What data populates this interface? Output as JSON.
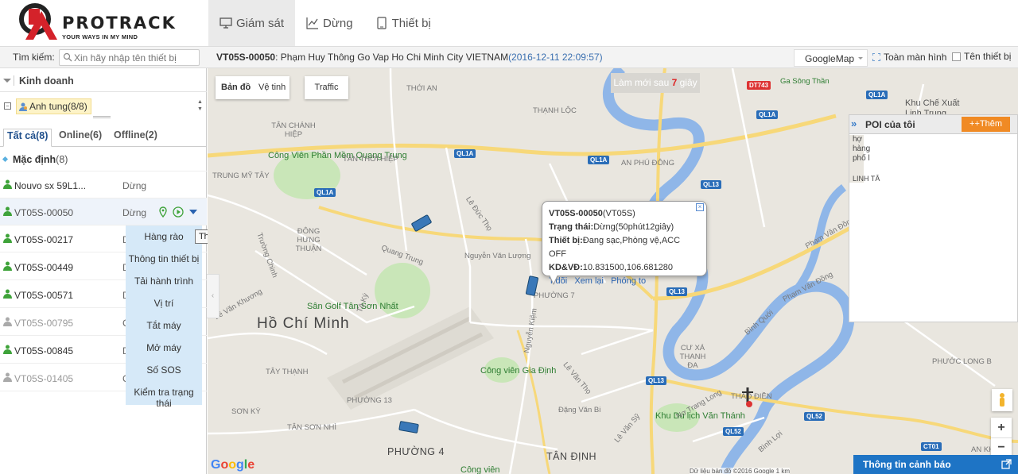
{
  "app": {
    "brand": "PROTRACK",
    "tagline": "YOUR WAYS IN MY MIND"
  },
  "nav": [
    {
      "label": "Giám sát",
      "icon": "monitor-icon",
      "active": true
    },
    {
      "label": "Dừng",
      "icon": "line-chart-icon",
      "active": false
    },
    {
      "label": "Thiết bị",
      "icon": "device-icon",
      "active": false
    }
  ],
  "toolbar": {
    "search_label": "Tìm kiếm:",
    "search_placeholder": "Xin hãy nhập tên thiết bị",
    "device_id": "VT05S-00050",
    "device_address": ": Phạm Huy Thông Go Vap Ho Chi Minh City VIETNAM",
    "device_time": "(2016-12-11 22:09:57)",
    "map_type": "GoogleMap",
    "fullscreen_label": "Toàn màn hình",
    "device_name_label": "Tên thiết bị"
  },
  "sidebar": {
    "business": "Kinh doanh",
    "group": "Anh tung(8/8)",
    "tabs": [
      {
        "label": "Tất cả(8)",
        "active": true
      },
      {
        "label": "Online(6)",
        "active": false
      },
      {
        "label": "Offline(2)",
        "active": false
      }
    ],
    "default_group": {
      "name": "Mặc định",
      "count": "(8)"
    },
    "vehicles": [
      {
        "name": "Nouvo sx 59L1...",
        "status": "Dừng",
        "online": true
      },
      {
        "name": "VT05S-00050",
        "status": "Dừng",
        "online": true
      },
      {
        "name": "VT05S-00217",
        "status": "D",
        "online": true
      },
      {
        "name": "VT05S-00449",
        "status": "D",
        "online": true
      },
      {
        "name": "VT05S-00571",
        "status": "D",
        "online": true
      },
      {
        "name": "VT05S-00795",
        "status": "C",
        "online": false
      },
      {
        "name": "VT05S-00845",
        "status": "D",
        "online": true
      },
      {
        "name": "VT05S-01405",
        "status": "C",
        "online": false
      }
    ],
    "context_menu": [
      "Hàng rào",
      "Thông tin thiết bị",
      "Tải hành trình",
      "Vị trí",
      "Tắt máy",
      "Mở máy",
      "Số SOS",
      "Kiểm tra trạng thái"
    ],
    "tooltip": "Thêm"
  },
  "map": {
    "controls": {
      "map": "Bản đồ",
      "satellite": "Vệ tinh",
      "traffic": "Traffic"
    },
    "refresh_prefix": "Làm mới sau ",
    "refresh_seconds": "7",
    "refresh_suffix": " giây",
    "popup": {
      "title": "VT05S-00050",
      "model": "(VT05S)",
      "status_label": "Trạng thái:",
      "status_value": "Dừng(50phút12giây)",
      "device_label": "Thiết bị:",
      "device_value": "Đang sạc,Phòng vệ,ACC OFF",
      "coord_label": "KD&VĐ:",
      "coord_value": "10.831500,106.681280",
      "links": [
        "T.dõi",
        "Xem lại",
        "Phóng to"
      ]
    },
    "poi": {
      "title": "POI của tôi",
      "add": "++Thêm",
      "peek": [
        "Khu Chế Xuất",
        "Linh Trung",
        "hợ",
        "hàng",
        "phố l",
        "LINH TÂ"
      ]
    },
    "alert_bar": "Thông tin cảnh báo",
    "google": "Google",
    "attribution": "Dữ liệu bản đồ ©2016 Google   1 km",
    "places": {
      "city": "Hồ Chí Minh",
      "parks": [
        "Công Viên Phần Mềm Quang Trung",
        "Sân Golf Tân Sơn Nhất",
        "Công viên Gia Định",
        "Khu Du lịch Văn Thánh",
        "Công viên"
      ],
      "districts": [
        "THỚI AN",
        "TÂN CHÁNH HIỆP",
        "TÂN THỚI HIỆP",
        "THẠNH LỘC",
        "AN PHÚ ĐÔNG",
        "TRUNG MỸ TÂY",
        "ĐÔNG HƯNG THUẬN",
        "TÂY THẠNH",
        "SƠN KỲ",
        "PHƯỜNG 13",
        "TÂN SƠN NHÌ",
        "PHƯỜNG 4",
        "TÂN ĐỊNH",
        "CƯ XÁ THANH ĐA",
        "THẢO ĐIỀN",
        "PHƯỜNG 7",
        "PHƯỚC LONG B",
        "AN KHÁNH",
        "Ga Sông Thần"
      ],
      "roads": [
        "QL1A",
        "QL13",
        "QL52",
        "DT743",
        "CT01",
        "Phạm Văn Đồng",
        "Quang Trung",
        "Nguyễn Văn Lượng",
        "Lê Đức Thọ",
        "Nguyễn Kiệm",
        "Lê Văn Khương",
        "Trường Chinh",
        "Tô Ký",
        "Bình Quới",
        "Nơ Trang Long",
        "Lê Văn Thọ",
        "Đặng Văn Bi",
        "Bình Lợi",
        "Lê Văn Sỹ"
      ]
    }
  }
}
